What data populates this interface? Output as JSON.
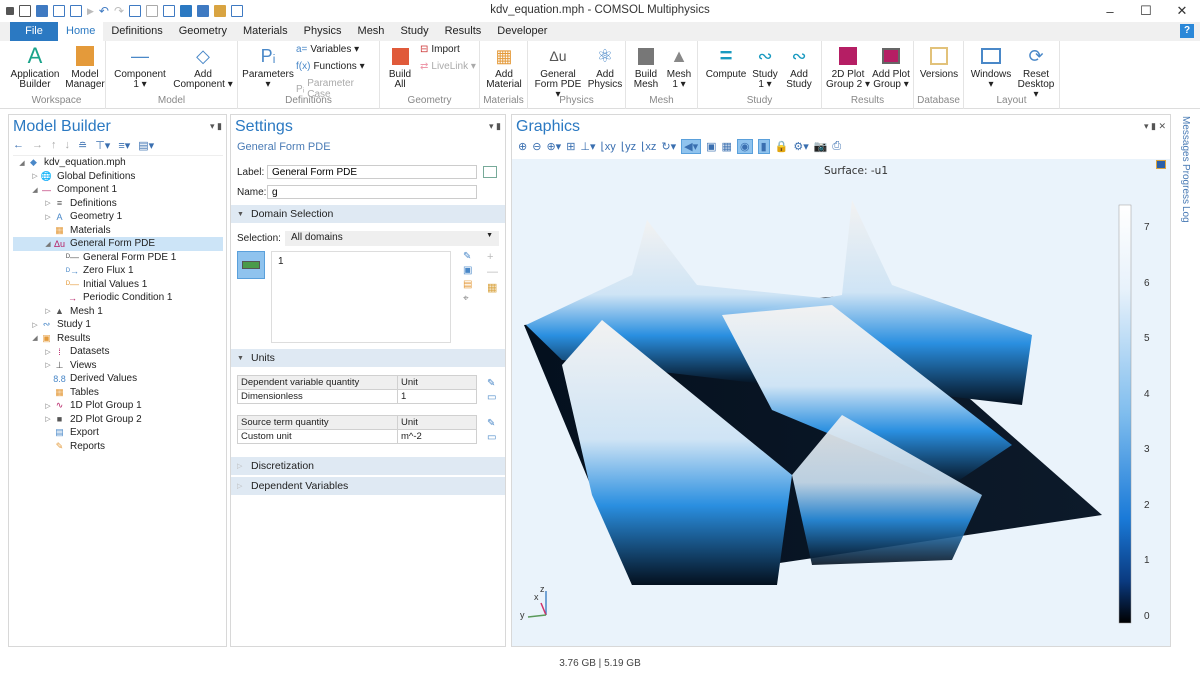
{
  "window": {
    "title": "kdv_equation.mph - COMSOL Multiphysics",
    "controls": [
      "minimize",
      "maximize",
      "close"
    ]
  },
  "quick_access": [
    "new-icon",
    "open-icon",
    "save-icon",
    "save-as-icon",
    "run-icon",
    "undo-icon",
    "redo-icon",
    "copy-icon",
    "paste-icon",
    "duplicate-icon",
    "delete-icon",
    "select-icon",
    "clear-icon",
    "find-icon"
  ],
  "menu_tabs": [
    "File",
    "Home",
    "Definitions",
    "Geometry",
    "Materials",
    "Physics",
    "Mesh",
    "Study",
    "Results",
    "Developer"
  ],
  "active_tab": "Home",
  "help_label": "?",
  "ribbon": {
    "groups": [
      {
        "label": "Workspace",
        "buttons": [
          "Application Builder",
          "Model Manager"
        ]
      },
      {
        "label": "Model",
        "buttons": [
          "Component 1 ▾",
          "Add Component ▾"
        ]
      },
      {
        "label": "Definitions",
        "buttons": [
          "Parameters ▾"
        ],
        "small": [
          "Variables ▾",
          "Functions ▾",
          "Parameter Case"
        ]
      },
      {
        "label": "Geometry",
        "buttons": [
          "Build All"
        ],
        "small": [
          "Import",
          "LiveLink ▾"
        ]
      },
      {
        "label": "Materials",
        "buttons": [
          "Add Material"
        ]
      },
      {
        "label": "Physics",
        "buttons": [
          "General Form PDE ▾",
          "Add Physics"
        ]
      },
      {
        "label": "Mesh",
        "buttons": [
          "Build Mesh",
          "Mesh 1 ▾"
        ]
      },
      {
        "label": "Study",
        "buttons": [
          "Compute",
          "Study 1 ▾",
          "Add Study"
        ]
      },
      {
        "label": "Results",
        "buttons": [
          "2D Plot Group 2 ▾",
          "Add Plot Group ▾"
        ]
      },
      {
        "label": "Database",
        "buttons": [
          "Versions"
        ]
      },
      {
        "label": "Layout",
        "buttons": [
          "Windows ▾",
          "Reset Desktop ▾"
        ]
      }
    ]
  },
  "model_builder": {
    "title": "Model Builder",
    "tree": [
      {
        "label": "kdv_equation.mph",
        "level": 0,
        "toggle": "◢",
        "icon": "◆"
      },
      {
        "label": "Global Definitions",
        "level": 1,
        "toggle": "▷",
        "icon": "🌐"
      },
      {
        "label": "Component 1",
        "level": 1,
        "toggle": "◢",
        "icon": "—"
      },
      {
        "label": "Definitions",
        "level": 2,
        "toggle": "▷",
        "icon": "≡"
      },
      {
        "label": "Geometry 1",
        "level": 2,
        "toggle": "▷",
        "icon": "A"
      },
      {
        "label": "Materials",
        "level": 2,
        "toggle": "",
        "icon": "▦"
      },
      {
        "label": "General Form PDE",
        "level": 2,
        "toggle": "◢",
        "icon": "Δu",
        "selected": true
      },
      {
        "label": "General Form PDE 1",
        "level": 3,
        "toggle": "",
        "icon": "ᴰ—"
      },
      {
        "label": "Zero Flux 1",
        "level": 3,
        "toggle": "",
        "icon": "ᴰ→"
      },
      {
        "label": "Initial Values 1",
        "level": 3,
        "toggle": "",
        "icon": "ᴰ—"
      },
      {
        "label": "Periodic Condition 1",
        "level": 3,
        "toggle": "",
        "icon": "→"
      },
      {
        "label": "Mesh 1",
        "level": 2,
        "toggle": "▷",
        "icon": "▲"
      },
      {
        "label": "Study 1",
        "level": 1,
        "toggle": "▷",
        "icon": "∾"
      },
      {
        "label": "Results",
        "level": 1,
        "toggle": "◢",
        "icon": "▣"
      },
      {
        "label": "Datasets",
        "level": 2,
        "toggle": "▷",
        "icon": "⁞"
      },
      {
        "label": "Views",
        "level": 2,
        "toggle": "▷",
        "icon": "⊥"
      },
      {
        "label": "Derived Values",
        "level": 2,
        "toggle": "",
        "icon": "8.8"
      },
      {
        "label": "Tables",
        "level": 2,
        "toggle": "",
        "icon": "▦"
      },
      {
        "label": "1D Plot Group 1",
        "level": 2,
        "toggle": "▷",
        "icon": "∿"
      },
      {
        "label": "2D Plot Group 2",
        "level": 2,
        "toggle": "▷",
        "icon": "■"
      },
      {
        "label": "Export",
        "level": 2,
        "toggle": "",
        "icon": "▤"
      },
      {
        "label": "Reports",
        "level": 2,
        "toggle": "",
        "icon": "✎"
      }
    ]
  },
  "settings": {
    "title": "Settings",
    "subtitle": "General Form PDE",
    "label_caption": "Label:",
    "label_value": "General Form PDE",
    "name_caption": "Name:",
    "name_value": "g",
    "domain_section": "Domain Selection",
    "selection_caption": "Selection:",
    "selection_value": "All domains",
    "selection_list": [
      "1"
    ],
    "units_section": "Units",
    "units": [
      {
        "quantity": "Dependent variable quantity",
        "unit_header": "Unit",
        "value": "Dimensionless",
        "unit": "1"
      },
      {
        "quantity": "Source term quantity",
        "unit_header": "Unit",
        "value": "Custom unit",
        "unit": "m^-2"
      }
    ],
    "discretization_section": "Discretization",
    "dependent_vars_section": "Dependent Variables"
  },
  "graphics": {
    "title": "Graphics",
    "plot_title": "Surface: -u1",
    "colorbar": {
      "min": 0,
      "max": 7,
      "ticks": [
        "7",
        "6",
        "5",
        "4",
        "3",
        "2",
        "1",
        "0"
      ]
    },
    "axes": {
      "x": "x",
      "y": "y",
      "z": "z"
    }
  },
  "side_tabs": [
    "Messages",
    "Progress",
    "Log"
  ],
  "status": {
    "memory": "3.76 GB | 5.19 GB"
  }
}
